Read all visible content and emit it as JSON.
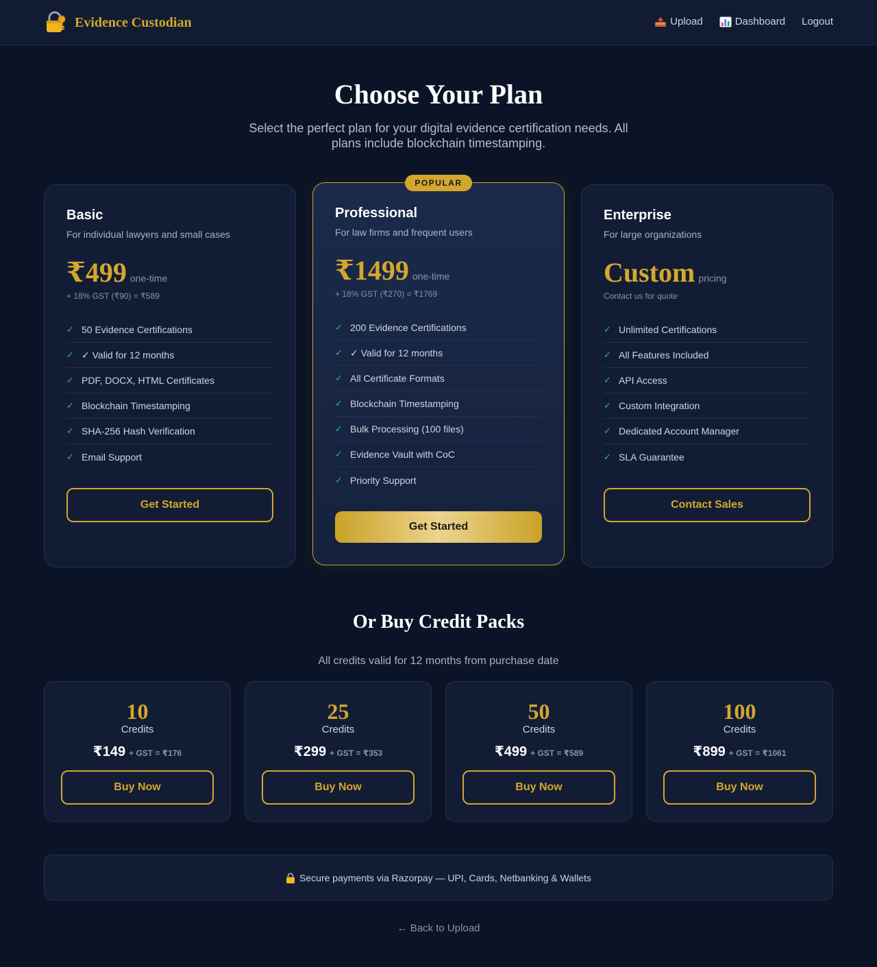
{
  "header": {
    "brand": "Evidence Custodian",
    "brand_icon": "locked-with-key-icon",
    "nav": [
      {
        "label": "Upload",
        "icon": "outbox-tray-icon"
      },
      {
        "label": "Dashboard",
        "icon": "bar-chart-icon"
      },
      {
        "label": "Logout"
      }
    ]
  },
  "hero": {
    "title": "Choose Your Plan",
    "subtitle": "Select the perfect plan for your digital evidence certification needs. All plans include blockchain timestamping."
  },
  "plans": [
    {
      "name": "Basic",
      "description": "For individual lawyers and small cases",
      "price": "₹499",
      "period": "one-time",
      "note": "+ 18% GST (₹90) = ₹589",
      "features": [
        "50 Evidence Certifications",
        "✓ Valid for 12 months",
        "PDF, DOCX, HTML Certificates",
        "Blockchain Timestamping",
        "SHA-256 Hash Verification",
        "Email Support"
      ],
      "button": "Get Started"
    },
    {
      "name": "Professional",
      "badge": "POPULAR",
      "description": "For law firms and frequent users",
      "price": "₹1499",
      "period": "one-time",
      "note": "+ 18% GST (₹270) = ₹1769",
      "features": [
        "200 Evidence Certifications",
        "✓ Valid for 12 months",
        "All Certificate Formats",
        "Blockchain Timestamping",
        "Bulk Processing (100 files)",
        "Evidence Vault with CoC",
        "Priority Support"
      ],
      "button": "Get Started"
    },
    {
      "name": "Enterprise",
      "description": "For large organizations",
      "price": "Custom",
      "period": "pricing",
      "note": "Contact us for quote",
      "features": [
        "Unlimited Certifications",
        "All Features Included",
        "API Access",
        "Custom Integration",
        "Dedicated Account Manager",
        "SLA Guarantee"
      ],
      "button": "Contact Sales"
    }
  ],
  "credits": {
    "title": "Or Buy Credit Packs",
    "subtitle": "All credits valid for 12 months from purchase date",
    "packs": [
      {
        "count": "10",
        "label": "Credits",
        "price": "₹149",
        "gst": "+ GST = ₹176",
        "button": "Buy Now"
      },
      {
        "count": "25",
        "label": "Credits",
        "price": "₹299",
        "gst": "+ GST = ₹353",
        "button": "Buy Now"
      },
      {
        "count": "50",
        "label": "Credits",
        "price": "₹499",
        "gst": "+ GST = ₹589",
        "button": "Buy Now"
      },
      {
        "count": "100",
        "label": "Credits",
        "price": "₹899",
        "gst": "+ GST = ₹1061",
        "button": "Buy Now"
      }
    ]
  },
  "secure_note": "Secure payments via Razorpay — UPI, Cards, Netbanking & Wallets",
  "secure_icon": "lock-icon",
  "back_link": "← Back to Upload",
  "colors": {
    "background": "#0b1426",
    "card": "#121d35",
    "accent_gold": "#d4a72c",
    "check_green": "#22c55e"
  }
}
